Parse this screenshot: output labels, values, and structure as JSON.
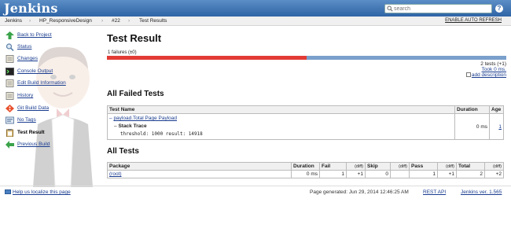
{
  "header": {
    "logo": "Jenkins",
    "search_placeholder": "search",
    "help": "?"
  },
  "breadcrumb": {
    "items": [
      "Jenkins",
      "HP_ResponsiveDesign",
      "#22",
      "Test Results"
    ],
    "auto_refresh": "ENABLE AUTO REFRESH"
  },
  "sidebar": {
    "items": [
      {
        "label": "Back to Project",
        "icon": "up-arrow-icon"
      },
      {
        "label": "Status",
        "icon": "search-icon"
      },
      {
        "label": "Changes",
        "icon": "notepad-icon"
      },
      {
        "label": "Console Output",
        "icon": "terminal-icon"
      },
      {
        "label": "Edit Build Information",
        "icon": "notepad-icon"
      },
      {
        "label": "History",
        "icon": "notepad-icon"
      },
      {
        "label": "Git Build Data",
        "icon": "git-icon"
      },
      {
        "label": "No Tags",
        "icon": "tag-icon"
      },
      {
        "label": "Test Result",
        "icon": "clipboard-icon"
      },
      {
        "label": "Previous Build",
        "icon": "left-arrow-icon"
      }
    ]
  },
  "main": {
    "title": "Test Result",
    "failures": "1 failures (±0)",
    "fail_fraction": 0.5,
    "tests_count": "2 tests (+1)",
    "took": "Took 0 ms.",
    "add_description": "add description",
    "failed_section": "All Failed Tests",
    "failed_table": {
      "headers": [
        "Test Name",
        "Duration",
        "Age"
      ],
      "row": {
        "name": "payload.Total Page Payload",
        "toggle": "–",
        "duration": "0 ms",
        "age": "1"
      },
      "stack_trace_label": "Stack Trace",
      "stack_trace_toggle": "–",
      "stack_trace": "threshold: 1000 result: 14918"
    },
    "all_section": "All Tests",
    "all_table": {
      "headers": [
        "Package",
        "Duration",
        "Fail",
        "(diff)",
        "Skip",
        "(diff)",
        "Pass",
        "(diff)",
        "Total",
        "(diff)"
      ],
      "row": [
        "(root)",
        "0 ms",
        "1",
        "+1",
        "0",
        "",
        "1",
        "+1",
        "2",
        "+2"
      ]
    }
  },
  "footer": {
    "localize": "Help us localize this page",
    "generated": "Page generated: Jun 29, 2014 12:46:25 AM",
    "rest_api": "REST API",
    "version": "Jenkins ver. 1.565"
  },
  "colors": {
    "header": "#3a6fb0",
    "fail": "#e23b35",
    "pass": "#7aa0cc",
    "link": "#1a3d8f"
  }
}
